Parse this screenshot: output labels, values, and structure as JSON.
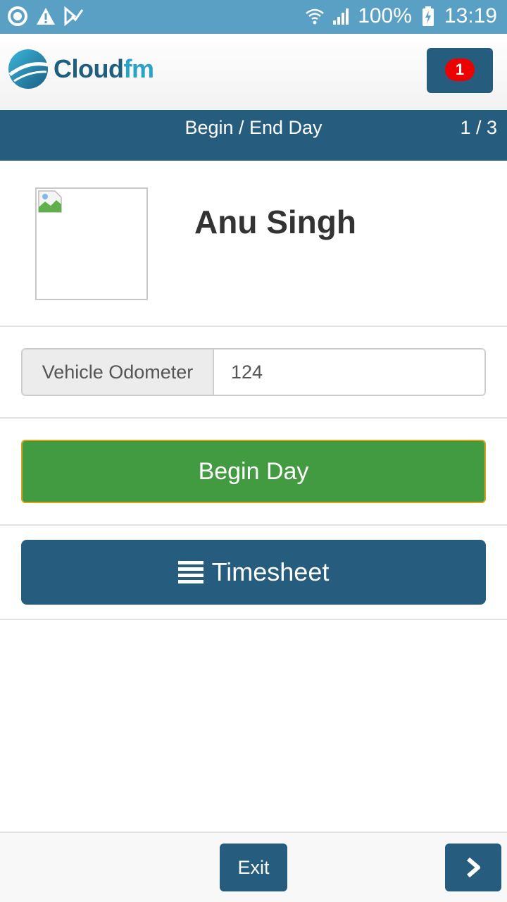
{
  "status_bar": {
    "battery": "100%",
    "time": "13:19",
    "left_icons": [
      "sync-icon",
      "warning-icon",
      "task-check-icon"
    ],
    "right_icons": [
      "wifi-icon",
      "signal-icon",
      "battery-charging-icon"
    ]
  },
  "header": {
    "logo_text_main": "Cloud",
    "logo_text_accent": "fm",
    "notification_count": "1"
  },
  "titlebar": {
    "title": "Begin / End Day",
    "pager": "1 / 3"
  },
  "profile": {
    "name": "Anu Singh"
  },
  "odometer": {
    "label": "Vehicle Odometer",
    "value": "124"
  },
  "actions": {
    "begin_day_label": "Begin Day",
    "timesheet_label": "Timesheet"
  },
  "footer": {
    "exit_label": "Exit",
    "next_icon": "chevron-right-icon"
  },
  "colors": {
    "status_bar": "#5a9fc4",
    "primary": "#265d7e",
    "success": "#429a41",
    "badge": "#ee0000"
  }
}
